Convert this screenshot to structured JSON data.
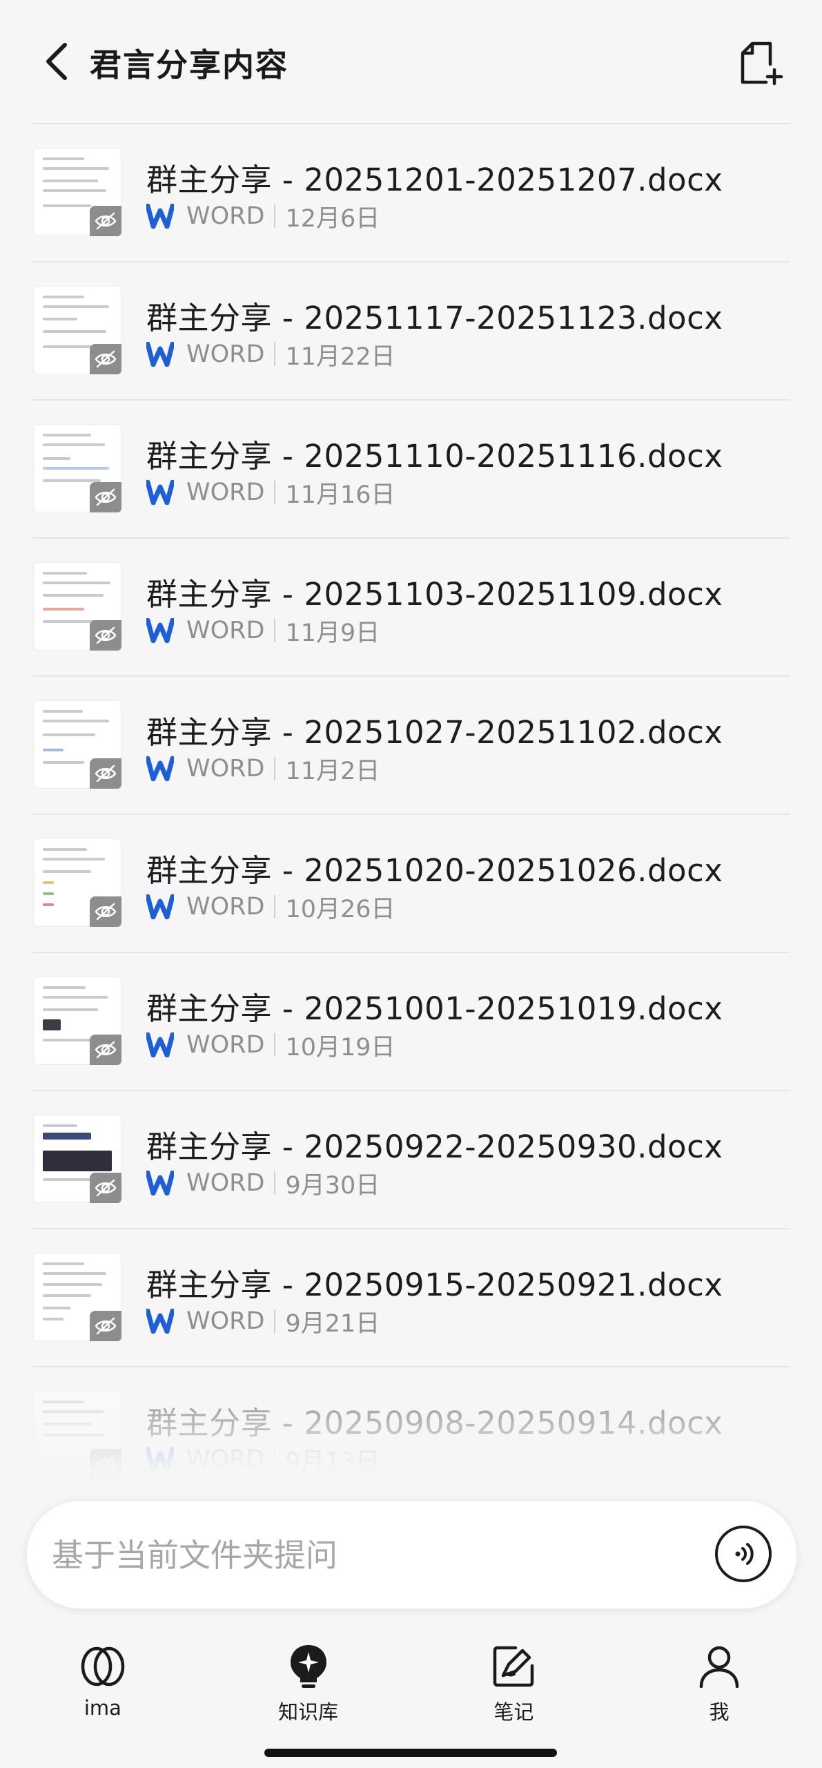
{
  "header": {
    "title": "君言分享内容"
  },
  "files": [
    {
      "name": "群主分享 - 20251201-20251207.docx",
      "type": "WORD",
      "date": "12月6日"
    },
    {
      "name": "群主分享 - 20251117-20251123.docx",
      "type": "WORD",
      "date": "11月22日"
    },
    {
      "name": "群主分享 - 20251110-20251116.docx",
      "type": "WORD",
      "date": "11月16日"
    },
    {
      "name": "群主分享 - 20251103-20251109.docx",
      "type": "WORD",
      "date": "11月9日"
    },
    {
      "name": "群主分享 - 20251027-20251102.docx",
      "type": "WORD",
      "date": "11月2日"
    },
    {
      "name": "群主分享 - 20251020-20251026.docx",
      "type": "WORD",
      "date": "10月26日"
    },
    {
      "name": "群主分享 - 20251001-20251019.docx",
      "type": "WORD",
      "date": "10月19日"
    },
    {
      "name": "群主分享 - 20250922-20250930.docx",
      "type": "WORD",
      "date": "9月30日"
    },
    {
      "name": "群主分享 - 20250915-20250921.docx",
      "type": "WORD",
      "date": "9月21日"
    },
    {
      "name": "群主分享 - 20250908-20250914.docx",
      "type": "WORD",
      "date": "9月13日"
    }
  ],
  "ask": {
    "placeholder": "基于当前文件夹提问"
  },
  "nav": {
    "items": [
      {
        "label": "ima",
        "icon": "ima-logo-icon"
      },
      {
        "label": "知识库",
        "icon": "knowledge-base-icon"
      },
      {
        "label": "笔记",
        "icon": "note-icon"
      },
      {
        "label": "我",
        "icon": "profile-icon"
      }
    ]
  },
  "colors": {
    "word_blue": "#1f5fd6",
    "badge_gray": "#8d8d8d",
    "background": "#f6f6f7"
  }
}
